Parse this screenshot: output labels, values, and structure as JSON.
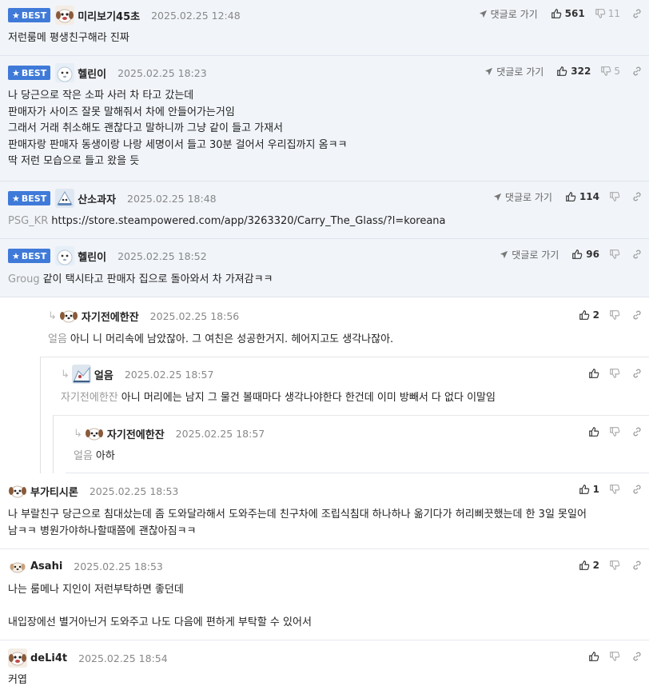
{
  "comments": [
    {
      "best_label": "BEST",
      "nick": "미리보기45초",
      "date": "2025.02.25 12:48",
      "goto_label": "댓글로 가기",
      "up": "561",
      "down": "11",
      "lines": [
        "저런룸메 평생친구해라 진짜"
      ]
    },
    {
      "best_label": "BEST",
      "nick": "헬린이",
      "date": "2025.02.25 18:23",
      "goto_label": "댓글로 가기",
      "up": "322",
      "down": "5",
      "lines": [
        "나 당근으로 작은 소파 사러 차 타고 갔는데",
        "판매자가 사이즈 잘못 말해줘서 차에 안들어가는거임",
        "그래서 거래 취소해도 괜찮다고 말하니까 그냥 같이 들고 가재서",
        "판매자랑 판매자 동생이랑 나랑 세명이서 들고 30분 걸어서 우리집까지 옴ㅋㅋ",
        "딱 저런 모습으로 들고 왔을 듯"
      ]
    },
    {
      "best_label": "BEST",
      "nick": "산소과자",
      "date": "2025.02.25 18:48",
      "goto_label": "댓글로 가기",
      "up": "114",
      "ref": "PSG_KR",
      "text": "https://store.steampowered.com/app/3263320/Carry_The_Glass/?l=koreana"
    },
    {
      "best_label": "BEST",
      "nick": "헬린이",
      "date": "2025.02.25 18:52",
      "goto_label": "댓글로 가기",
      "up": "96",
      "ref": "Groug",
      "text": "같이 택시타고 판매자 집으로 돌아와서 차 가져감ㅋㅋ"
    },
    {
      "nick": "자기전에한잔",
      "date": "2025.02.25 18:56",
      "up": "2",
      "ref": "얼음",
      "text": "아니 니 머리속에 남았잖아. 그 여친은 성공한거지. 헤어지고도 생각나잖아."
    },
    {
      "nick": "얼음",
      "date": "2025.02.25 18:57",
      "ref": "자기전에한잔",
      "text": "아니 머리에는 남지 그 물건 볼때마다 생각나야한다 한건데 이미 방빼서 다 없다 이말임"
    },
    {
      "nick": "자기전에한잔",
      "date": "2025.02.25 18:57",
      "ref": "얼음",
      "text": "아하"
    },
    {
      "nick": "부가티시론",
      "date": "2025.02.25 18:53",
      "up": "1",
      "lines": [
        "나 부랄친구 당근으로 침대샀는데 좀 도와달라해서 도와주는데 친구차에 조립식침대 하나하나 옮기다가 허리삐끗했는데 한 3일 못일어",
        "남ㅋㅋ 병원가야하나할때쯤에 괜찮아짐ㅋㅋ"
      ]
    },
    {
      "nick": "Asahi",
      "date": "2025.02.25 18:53",
      "up": "2",
      "lines": [
        "나는 룸메나 지인이 저런부탁하면 좋던데",
        "",
        "내입장에선 별거아닌거 도와주고 나도 다음에 편하게 부탁할 수 있어서"
      ]
    },
    {
      "nick": "deLi4t",
      "date": "2025.02.25 18:54",
      "lines": [
        "커엽"
      ]
    }
  ],
  "colors": {
    "best_badge": "#3f7ad8",
    "best_bg": "#f1f4f9",
    "muted": "#999999"
  },
  "icons": {
    "thumb_up": "thumbs-up-icon",
    "thumb_down": "thumbs-down-icon",
    "link": "link-icon",
    "goto": "paper-plane-icon",
    "reply": "reply-arrow-icon",
    "best": "star-icon"
  }
}
